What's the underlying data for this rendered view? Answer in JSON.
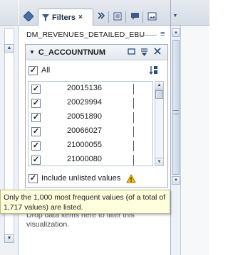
{
  "tabs": {
    "active_label": "Filters",
    "close_glyph": "×"
  },
  "data_source": {
    "name": "DM_REVENUES_DETAILED_EBU",
    "menu_icon": "≡"
  },
  "filter": {
    "title": "C_ACCOUNTNUM",
    "all_label": "All",
    "values": [
      "20015136",
      "20029994",
      "20051890",
      "20066027",
      "21000055",
      "21000080"
    ],
    "include_unlisted_label": "Include unlisted values",
    "check_glyph": "✓"
  },
  "tooltip": {
    "text": "Only the 1,000 most frequent values (of a total of 1,717 values) are listed."
  },
  "drop_area": {
    "line1": "Drop data items here to filter this",
    "line2": "visualization."
  },
  "icons": {
    "visualization_tab": "visualization-icon",
    "filters_tab": "funnel-icon",
    "tab_2": "double-chevron-icon",
    "tab_3": "list-icon",
    "tab_4": "comment-icon",
    "tab_5": "image-icon",
    "header_minimize": "minimize-icon",
    "header_options": "options-menu-icon",
    "header_close": "close-icon",
    "sort": "sort-icon",
    "warning": "warning-icon"
  },
  "colors": {
    "tooltip_bg": "#ffffdd",
    "accent": "#2b4a78",
    "warning": "#e8a400"
  }
}
